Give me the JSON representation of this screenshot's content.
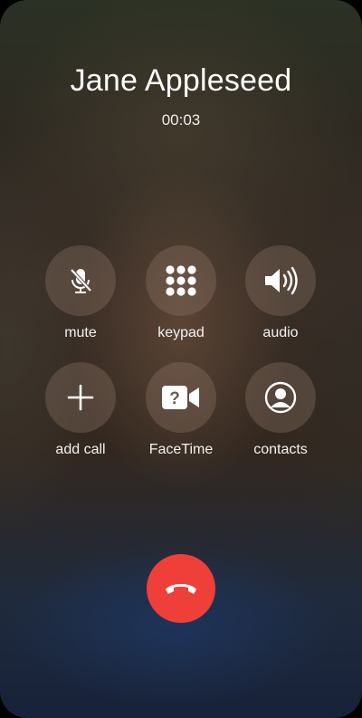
{
  "call": {
    "caller_name": "Jane Appleseed",
    "timer": "00:03"
  },
  "controls": [
    {
      "label": "mute",
      "icon": "mute-icon"
    },
    {
      "label": "keypad",
      "icon": "keypad-icon"
    },
    {
      "label": "audio",
      "icon": "speaker-icon"
    },
    {
      "label": "add call",
      "icon": "plus-icon"
    },
    {
      "label": "FaceTime",
      "icon": "facetime-icon"
    },
    {
      "label": "contacts",
      "icon": "contact-icon"
    }
  ],
  "end_call": {
    "icon": "phone-hangup-icon",
    "color": "#ef3f39"
  },
  "colors": {
    "button_fill": "rgba(150,125,110,0.33)",
    "text": "#ffffff"
  }
}
